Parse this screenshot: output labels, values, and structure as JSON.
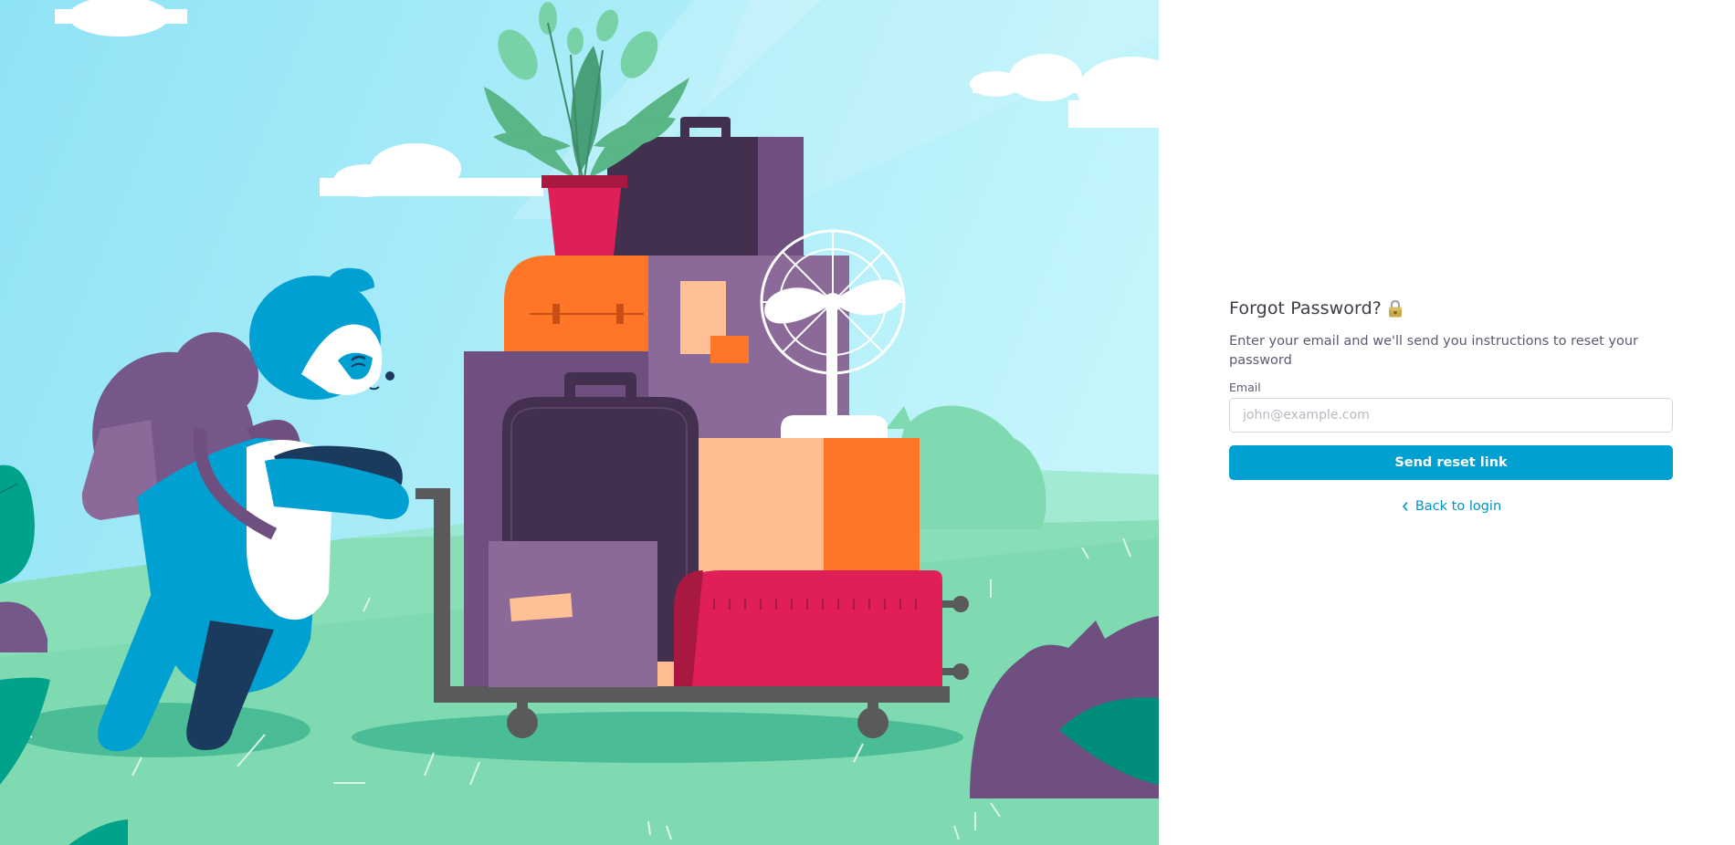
{
  "form": {
    "title": "Forgot Password?",
    "title_icon": "lock-icon",
    "subtitle": "Enter your email and we'll send you instructions to reset your password",
    "email_label": "Email",
    "email_placeholder": "john@example.com",
    "email_value": "",
    "submit_label": "Send reset link",
    "back_label": "Back to login",
    "back_icon": "chevron-left-icon"
  },
  "colors": {
    "primary": "#00a0d2",
    "link": "#0093c4",
    "sky": "#b7f0fa",
    "grass": "#7fdab1"
  }
}
